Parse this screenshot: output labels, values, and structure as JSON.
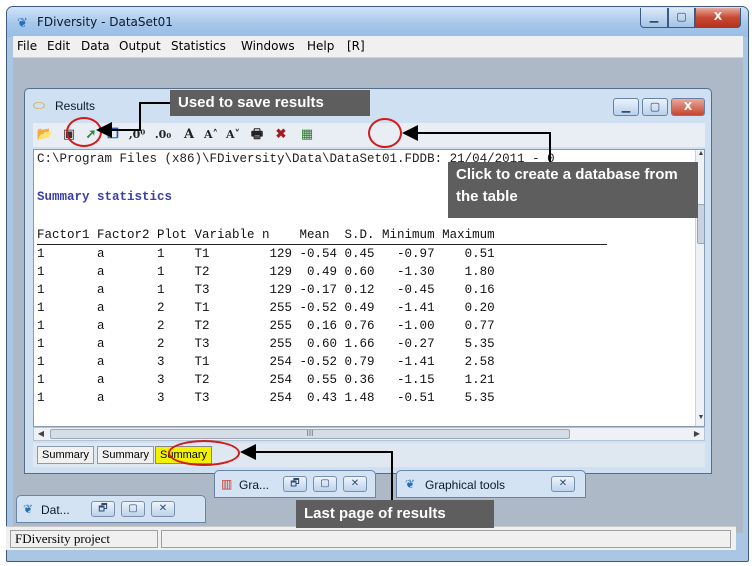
{
  "window": {
    "title": "FDiversity - DataSet01",
    "min": "▁",
    "max": "▢",
    "close": "X"
  },
  "menu": [
    "File",
    "Edit",
    "Data",
    "Output",
    "Statistics",
    "Windows",
    "Help",
    "[R]"
  ],
  "results": {
    "title": "Results",
    "path": "C:\\Program Files (x86)\\FDiversity\\Data\\DataSet01.FDDB: 21/04/2011 - 0",
    "heading": "Summary statistics",
    "header": "Factor1 Factor2 Plot Variable n    Mean  S.D. Minimum Maximum",
    "rows": [
      "1       a       1    T1        129 -0.54 0.45   -0.97    0.51",
      "1       a       1    T2        129  0.49 0.60   -1.30    1.80",
      "1       a       1    T3        129 -0.17 0.12   -0.45    0.16",
      "1       a       2    T1        255 -0.52 0.49   -1.41    0.20",
      "1       a       2    T2        255  0.16 0.76   -1.00    0.77",
      "1       a       2    T3        255  0.60 1.66   -0.27    5.35",
      "1       a       3    T1        254 -0.52 0.79   -1.41    2.58",
      "1       a       3    T2        254  0.55 0.36   -1.15    1.21",
      "1       a       3    T3        254  0.43 1.48   -0.51    5.35"
    ],
    "tabs": [
      "Summary",
      "Summary",
      "Summary"
    ],
    "scroll_grip": "III"
  },
  "toolbar": {
    "font_a": "A",
    "font_a_up": "A˄",
    "font_a_down": "A˅",
    "fmt1": ",0⁰",
    "fmt2": ".0₀"
  },
  "minimized": {
    "gra": "Gra...",
    "graphical_tools": "Graphical tools",
    "dat": "Dat..."
  },
  "status": {
    "project": "FDiversity project"
  },
  "annotations": {
    "save": "Used to save results",
    "database": "Click to create a database from the table",
    "last_page": "Last page of results"
  },
  "colors": {
    "accent_ring": "#d21b1b",
    "callout_bg": "#5e5e5e",
    "active_tab": "#f2f200",
    "heading_blue": "#3b3fa6"
  }
}
